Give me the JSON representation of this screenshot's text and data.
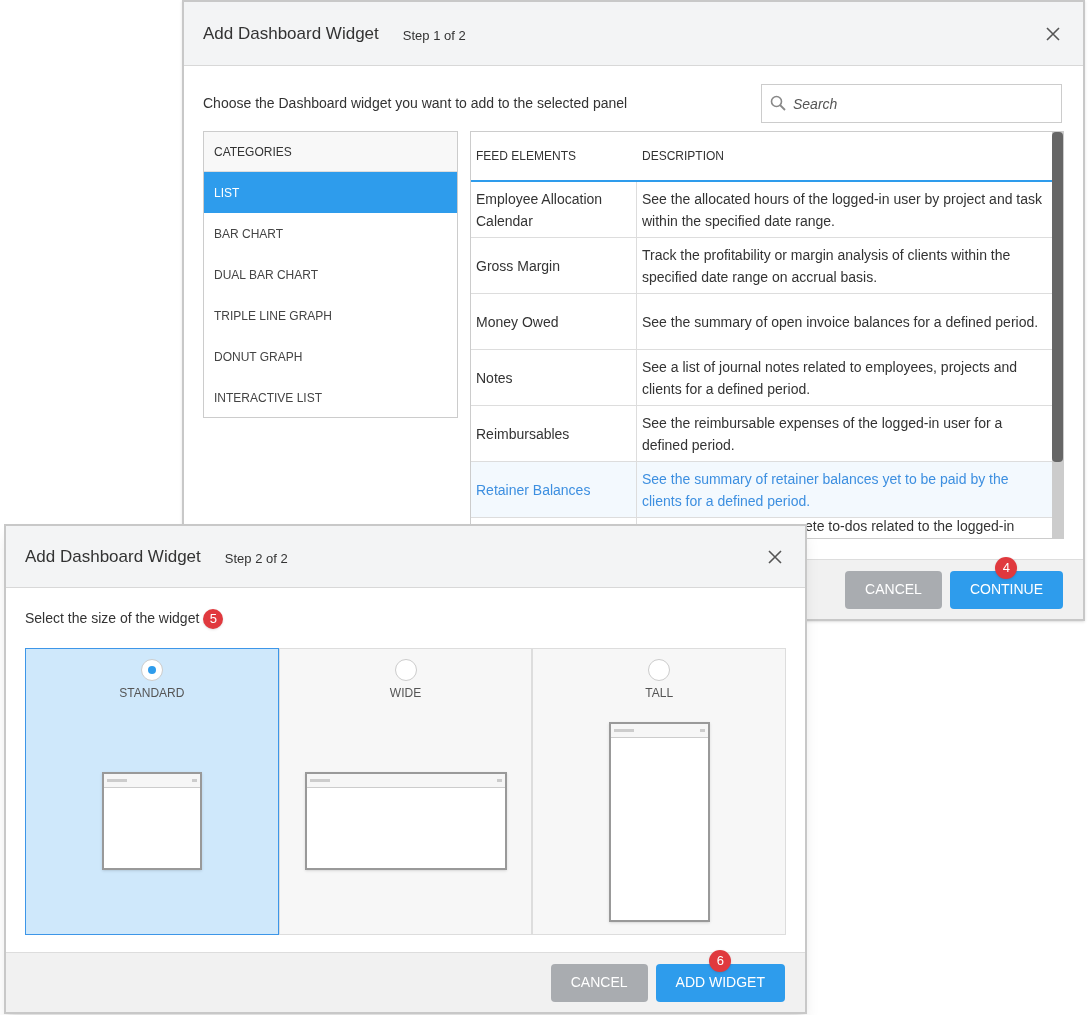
{
  "dialog_step1": {
    "title": "Add Dashboard Widget",
    "step": "Step 1 of 2",
    "instruction": "Choose the Dashboard widget you want to add to the selected panel",
    "search": {
      "placeholder": "Search"
    },
    "categories": {
      "heading": "CATEGORIES",
      "items": [
        {
          "label": "LIST",
          "selected": true
        },
        {
          "label": "BAR CHART",
          "selected": false
        },
        {
          "label": "DUAL BAR CHART",
          "selected": false
        },
        {
          "label": "TRIPLE LINE GRAPH",
          "selected": false
        },
        {
          "label": "DONUT GRAPH",
          "selected": false
        },
        {
          "label": "INTERACTIVE LIST",
          "selected": false
        }
      ]
    },
    "table": {
      "columns": [
        "FEED ELEMENTS",
        "DESCRIPTION"
      ],
      "rows": [
        {
          "name": "Employee Allocation Calendar",
          "description": "See the allocated hours of the logged-in user by project and task within the specified date range.",
          "selected": false
        },
        {
          "name": "Gross Margin",
          "description": "Track the profitability or margin analysis of clients within the specified date range on accrual basis.",
          "selected": false
        },
        {
          "name": "Money Owed",
          "description": "See the summary of open invoice balances for a defined period.",
          "selected": false
        },
        {
          "name": "Notes",
          "description": "See a list of journal notes related to employees, projects and clients for a defined period.",
          "selected": false
        },
        {
          "name": "Reimbursables",
          "description": "See the reimbursable expenses of the logged-in user for a defined period.",
          "selected": false
        },
        {
          "name": "Retainer Balances",
          "description": "See the summary of retainer balances yet to be paid by the clients for a defined period.",
          "selected": true
        },
        {
          "description": "ete to-dos related to the logged-in",
          "selected": false,
          "kind": "partial"
        }
      ]
    },
    "buttons": [
      {
        "label": "CANCEL",
        "kind": "secondary"
      },
      {
        "label": "CONTINUE",
        "kind": "primary",
        "badge": "4"
      }
    ]
  },
  "dialog_step2": {
    "title": "Add Dashboard Widget",
    "step": "Step 2 of 2",
    "instruction": "Select the size of the widget",
    "instruction_badge": "5",
    "sizes": [
      {
        "label": "STANDARD",
        "kind": "standard",
        "selected": true
      },
      {
        "label": "WIDE",
        "kind": "wide",
        "selected": false
      },
      {
        "label": "TALL",
        "kind": "tall",
        "selected": false
      }
    ],
    "buttons": [
      {
        "label": "CANCEL",
        "kind": "secondary"
      },
      {
        "label": "ADD WIDGET",
        "kind": "primary",
        "badge": "6"
      }
    ]
  }
}
